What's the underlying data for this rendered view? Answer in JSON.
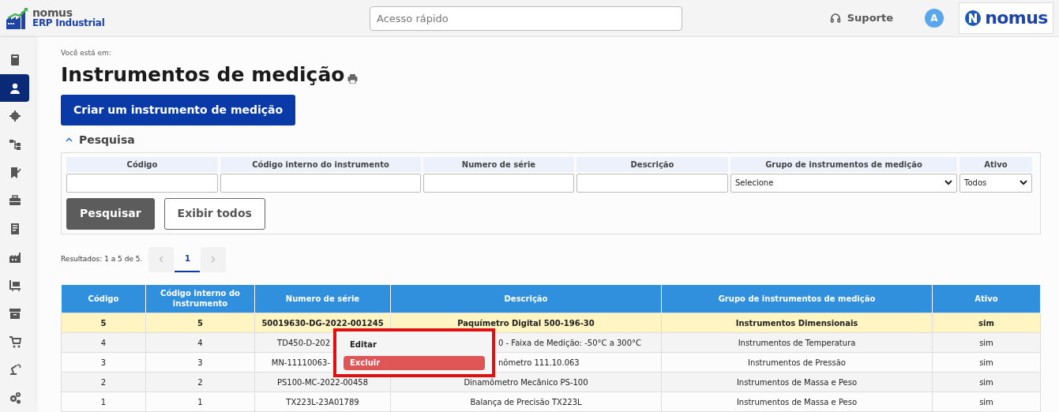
{
  "header": {
    "logo_name": "nomus",
    "logo_subtitle": "ERP Industrial",
    "quick_access": {
      "placeholder": "Acesso rápido"
    },
    "support": "Suporte",
    "avatar": "A",
    "brand": "nomus"
  },
  "sidebar": {
    "items": [
      {
        "selected": false
      },
      {
        "selected": true
      },
      {
        "selected": false
      },
      {
        "selected": false
      },
      {
        "selected": false
      },
      {
        "selected": false
      },
      {
        "selected": false
      },
      {
        "selected": false
      },
      {
        "selected": false
      },
      {
        "selected": false
      },
      {
        "selected": false
      },
      {
        "selected": false
      },
      {
        "selected": false
      }
    ]
  },
  "breadcrumb": "Você está em:",
  "title": "Instrumentos de medição",
  "create_button": "Criar um instrumento de medição",
  "search": {
    "title": "Pesquisa",
    "expanded": true,
    "fields": [
      {
        "label": "Código",
        "kind": "text"
      },
      {
        "label": "Código interno do instrumento",
        "kind": "text"
      },
      {
        "label": "Numero de série",
        "kind": "text"
      },
      {
        "label": "Descrição",
        "kind": "text"
      },
      {
        "label": "Grupo de instrumentos de medição",
        "kind": "select",
        "value": "Selecione"
      },
      {
        "label": "Ativo",
        "kind": "select",
        "value": "Todos"
      }
    ],
    "buttons": [
      {
        "label": "Pesquisar",
        "kind": "primary"
      },
      {
        "label": "Exibir todos",
        "kind": "secondary"
      }
    ]
  },
  "results": "Resultados: 1 a 5 de 5.",
  "pagination": {
    "pages": [
      {
        "label": "1",
        "selected": true
      }
    ]
  },
  "table": {
    "columns": [
      "Código",
      "Código interno do instrumento",
      "Numero de série",
      "Descrição",
      "Grupo de instrumentos de medição",
      "Ativo"
    ],
    "rows": [
      {
        "selected": true,
        "cells": [
          "5",
          "5",
          "50019630-DG-2022-001245",
          "Paquímetro Digital 500-196-30",
          "Instrumentos Dimensionais",
          "sim"
        ]
      },
      {
        "selected": false,
        "cells": [
          "4",
          "4",
          "TD450-D-202",
          "0 - Faixa de Medição: -50°C a 300°C",
          "Instrumentos de Temperatura",
          "sim"
        ]
      },
      {
        "selected": false,
        "cells": [
          "3",
          "3",
          "MN-11110063-",
          "nômetro 111.10.063",
          "Instrumentos de Pressão",
          "sim"
        ]
      },
      {
        "selected": false,
        "cells": [
          "2",
          "2",
          "PS100-MC-2022-00458",
          "Dinamômetro Mecânico PS-100",
          "Instrumentos de Massa e Peso",
          "sim"
        ]
      },
      {
        "selected": false,
        "cells": [
          "1",
          "1",
          "TX223L-23A01789",
          "Balança de Precisão TX223L",
          "Instrumentos de Massa e Peso",
          "sim"
        ]
      }
    ]
  },
  "context_menu": {
    "items": [
      {
        "label": "Editar",
        "kind": "plain"
      },
      {
        "label": "Excluir",
        "kind": "danger"
      }
    ]
  }
}
